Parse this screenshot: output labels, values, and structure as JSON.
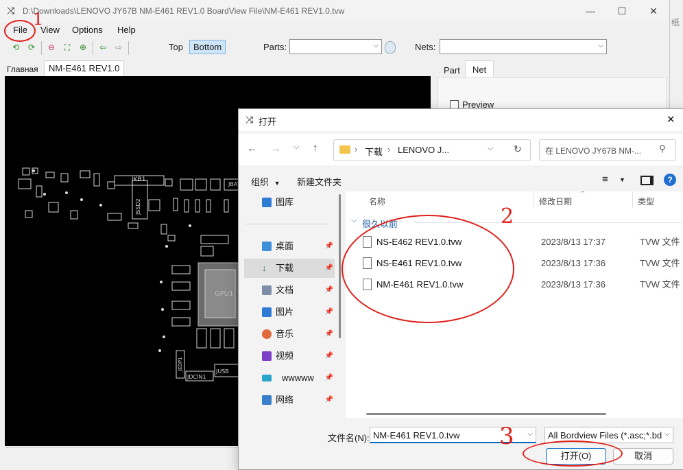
{
  "boardview": {
    "title": "D:\\Downloads\\LENOVO  JY67B NM-E461 REV1.0 BoardView File\\NM-E461 REV1.0.tvw",
    "menu": [
      "File",
      "View",
      "Options",
      "Help"
    ],
    "toolbar": {
      "top_label": "Top",
      "bottom_label": "Bottom",
      "parts_label": "Parts:",
      "nets_label": "Nets:"
    },
    "tabs": [
      "Главная",
      "NM-E461 REV1.0"
    ],
    "right_tabs": [
      "Part",
      "Net"
    ],
    "preview_label": "Preview",
    "board_labels": [
      "JKB1",
      "JSSD2",
      "JBAT",
      "GPU1",
      "JDCIN1",
      "JUSB",
      "JEDP1"
    ],
    "edge_text": "纸"
  },
  "dialog": {
    "title": "打开",
    "breadcrumb": [
      "下载",
      "LENOVO  J..."
    ],
    "search_placeholder": "在 LENOVO  JY67B NM-...",
    "organize_label": "组织",
    "new_folder_label": "新建文件夹",
    "nav_items": [
      {
        "label": "图库",
        "icon": "gallery-icon",
        "pin": false
      },
      {
        "label": "桌面",
        "icon": "desktop-icon",
        "pin": true
      },
      {
        "label": "下载",
        "icon": "download-icon",
        "pin": true,
        "selected": true
      },
      {
        "label": "文档",
        "icon": "documents-icon",
        "pin": true
      },
      {
        "label": "图片",
        "icon": "pictures-icon",
        "pin": true
      },
      {
        "label": "音乐",
        "icon": "music-icon",
        "pin": true
      },
      {
        "label": "视频",
        "icon": "videos-icon",
        "pin": true
      },
      {
        "label": "wwwww",
        "icon": "folder-icon",
        "pin": true
      },
      {
        "label": "网络",
        "icon": "network-icon",
        "pin": true
      }
    ],
    "columns": {
      "name": "名称",
      "date": "修改日期",
      "type": "类型"
    },
    "group_label": "很久以前",
    "files": [
      {
        "name": "NS-E462 REV1.0.tvw",
        "date": "2023/8/13 17:37",
        "type": "TVW 文件"
      },
      {
        "name": "NS-E461 REV1.0.tvw",
        "date": "2023/8/13 17:36",
        "type": "TVW 文件"
      },
      {
        "name": "NM-E461 REV1.0.tvw",
        "date": "2023/8/13 17:36",
        "type": "TVW 文件"
      }
    ],
    "filename_label": "文件名(N):",
    "filename_value": "NM-E461 REV1.0.tvw",
    "filter_value": "All Bordview Files (*.asc;*.bd",
    "open_label": "打开(O)",
    "cancel_label": "取消"
  },
  "annotations": {
    "step1": "1",
    "step2": "2",
    "step3": "3"
  },
  "colors": {
    "annotation": "#e0201a",
    "selection": "#cce4f7",
    "accent": "#0067c0"
  }
}
